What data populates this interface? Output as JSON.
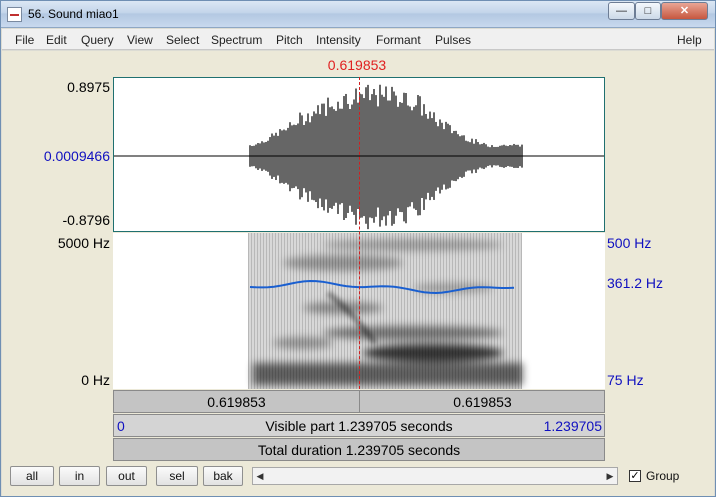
{
  "window": {
    "title": "56. Sound miao1"
  },
  "menu": [
    "File",
    "Edit",
    "Query",
    "View",
    "Select",
    "Spectrum",
    "Pitch",
    "Intensity",
    "Formant",
    "Pulses",
    "Help"
  ],
  "cursor_time": "0.619853",
  "waveform": {
    "max_label": "0.8975",
    "mid_label": "0.0009466",
    "min_label": "-0.8796"
  },
  "spectrogram": {
    "top_freq": "5000 Hz",
    "bottom_freq": "0 Hz"
  },
  "pitch": {
    "top": "500 Hz",
    "value": "361.2 Hz",
    "bottom": "75 Hz"
  },
  "bars": {
    "left_part": "0.619853",
    "right_part": "0.619853",
    "visible_start": "0",
    "visible_text": "Visible part 1.239705 seconds",
    "visible_end": "1.239705",
    "total_text": "Total duration 1.239705 seconds"
  },
  "buttons": {
    "all": "all",
    "in": "in",
    "out": "out",
    "sel": "sel",
    "bak": "bak"
  },
  "group": {
    "label": "Group",
    "checked": true
  },
  "colors": {
    "cursor": "#e02020",
    "axis_blue": "#1010c0",
    "pitch_line": "#1a5fd0"
  }
}
